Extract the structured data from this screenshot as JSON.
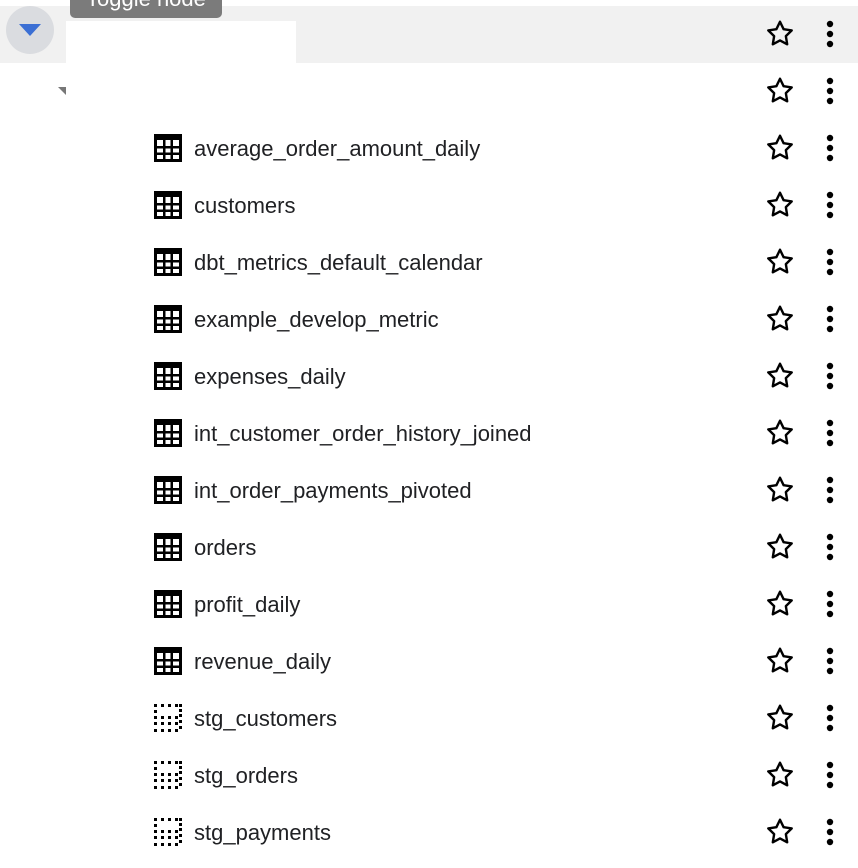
{
  "tooltip": {
    "text": "Toggle node"
  },
  "project": {
    "name": ""
  },
  "dataset": {
    "name": ""
  },
  "tables": [
    {
      "name": "average_order_amount_daily",
      "icon": "table-icon"
    },
    {
      "name": "customers",
      "icon": "table-icon"
    },
    {
      "name": "dbt_metrics_default_calendar",
      "icon": "table-icon"
    },
    {
      "name": "example_develop_metric",
      "icon": "table-icon"
    },
    {
      "name": "expenses_daily",
      "icon": "table-icon"
    },
    {
      "name": "int_customer_order_history_joined",
      "icon": "table-icon"
    },
    {
      "name": "int_order_payments_pivoted",
      "icon": "table-icon"
    },
    {
      "name": "orders",
      "icon": "table-icon"
    },
    {
      "name": "profit_daily",
      "icon": "table-icon"
    },
    {
      "name": "revenue_daily",
      "icon": "table-icon"
    },
    {
      "name": "stg_customers",
      "icon": "view-icon"
    },
    {
      "name": "stg_orders",
      "icon": "view-icon"
    },
    {
      "name": "stg_payments",
      "icon": "view-icon"
    }
  ],
  "colors": {
    "toggle_arrow": "#3b6fd4",
    "toggle_bg": "#dadce0",
    "project_row_bg": "#f1f1f1",
    "text": "#202124"
  }
}
